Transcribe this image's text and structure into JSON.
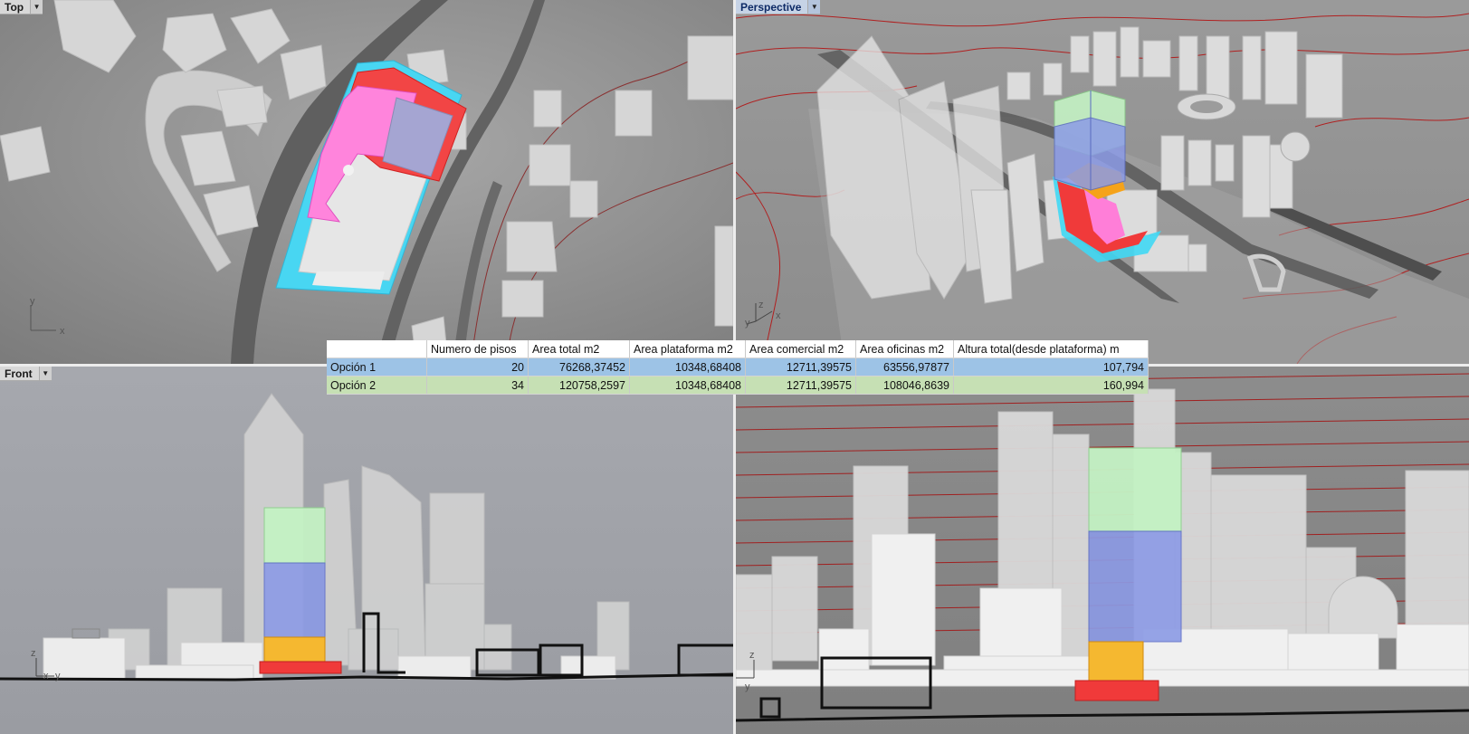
{
  "viewports": {
    "top": {
      "title": "Top",
      "axis_x": "x",
      "axis_y": "y"
    },
    "perspective": {
      "title": "Perspective",
      "axis_x": "x",
      "axis_y": "y",
      "axis_z": "z"
    },
    "front": {
      "title": "Front",
      "axis_z": "z",
      "axis_x": "x",
      "axis_y": "y"
    },
    "right": {
      "axis_z": "z",
      "axis_y": "y"
    }
  },
  "table": {
    "headers": [
      "",
      "Numero de pisos",
      "Area total m2",
      "Area plataforma m2",
      "Area comercial m2",
      "Area oficinas m2",
      "Altura total(desde plataforma) m"
    ],
    "rows": [
      {
        "label": "Opción 1",
        "pisos": "20",
        "area_total": "76268,37452",
        "area_plataforma": "10348,68408",
        "area_comercial": "12711,39575",
        "area_oficinas": "63556,97877",
        "altura_total": "107,794",
        "color": "#9dc3e6"
      },
      {
        "label": "Opción 2",
        "pisos": "34",
        "area_total": "120758,2597",
        "area_plataforma": "10348,68408",
        "area_comercial": "12711,39575",
        "area_oficinas": "108046,8639",
        "altura_total": "160,994",
        "color": "#c6e0b4"
      }
    ]
  },
  "colors": {
    "platform_red": "#f03a3a",
    "commercial_orange": "#f5a31a",
    "commercial_yellow": "#f4c84a",
    "office_blue": "#8c9be6",
    "top_green": "#c4f2c4",
    "pink": "#ff7ed8",
    "cyan": "#40d8f4",
    "contour_red": "#b02020"
  },
  "icons": {
    "dropdown": "chevron-down-icon"
  }
}
